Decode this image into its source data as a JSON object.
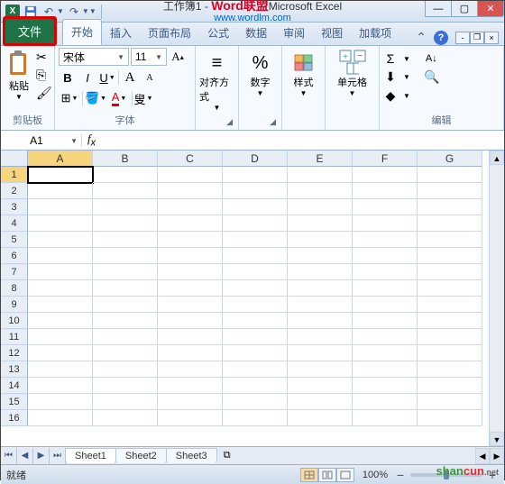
{
  "title": {
    "doc": "工作簿1",
    "app": "Microsoft Excel",
    "watermark1": "Word联盟",
    "watermark2": "www.wordlm.com"
  },
  "tabs": {
    "file": "文件",
    "items": [
      "开始",
      "插入",
      "页面布局",
      "公式",
      "数据",
      "审阅",
      "视图",
      "加载项"
    ],
    "active": 0
  },
  "ribbon": {
    "clipboard": {
      "paste": "粘贴",
      "label": "剪贴板"
    },
    "font": {
      "name": "宋体",
      "size": "11",
      "label": "字体",
      "wen": "叟"
    },
    "align": {
      "label": "对齐方式"
    },
    "number": {
      "label": "数字",
      "sym": "%"
    },
    "style": {
      "label": "样式"
    },
    "cells": {
      "label": "单元格"
    },
    "edit": {
      "label": "编辑",
      "sigma": "Σ"
    }
  },
  "namebox": "A1",
  "columns": [
    "A",
    "B",
    "C",
    "D",
    "E",
    "F",
    "G"
  ],
  "rowcount": 16,
  "sheets": {
    "tabs": [
      "Sheet1",
      "Sheet2",
      "Sheet3"
    ],
    "active": 0
  },
  "status": {
    "ready": "就绪",
    "zoom": "100%"
  },
  "branding": {
    "t1": "shan",
    "t2": "cun",
    "t3": ".net"
  },
  "chart_data": null
}
